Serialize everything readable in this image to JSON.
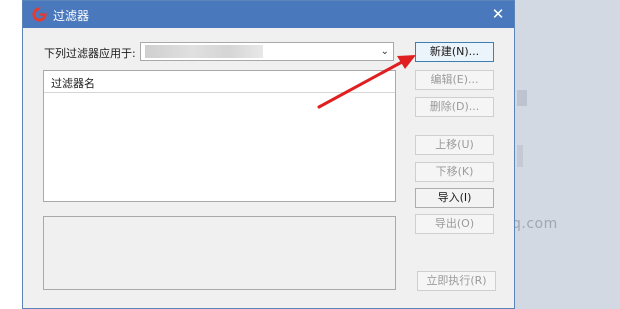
{
  "dialog": {
    "title": "过滤器",
    "close_glyph": "✕",
    "accent": "#4a78bd"
  },
  "apply": {
    "label": "下列过滤器应用于:",
    "selected_value": ""
  },
  "list": {
    "header": "过滤器名"
  },
  "buttons": {
    "new": "新建(N)...",
    "edit": "编辑(E)...",
    "delete": "删除(D)...",
    "up": "上移(U)",
    "down": "下移(K)",
    "import": "导入(I)",
    "export": "导出(O)",
    "run_now": "立即执行(R)"
  },
  "background": {
    "watermark": "q.com"
  },
  "annotation_color": "#e02020"
}
